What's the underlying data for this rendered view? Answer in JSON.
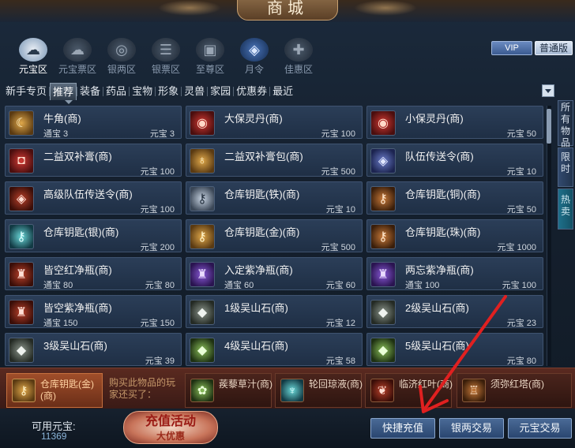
{
  "window": {
    "title": "商城"
  },
  "categories": [
    {
      "label": "元宝区",
      "icon": "ingot-icon",
      "active": true
    },
    {
      "label": "元宝票区",
      "icon": "cloud-ticket-icon",
      "active": false
    },
    {
      "label": "银两区",
      "icon": "silver-coins-icon",
      "active": false
    },
    {
      "label": "银票区",
      "icon": "silver-ticket-icon",
      "active": false
    },
    {
      "label": "至尊区",
      "icon": "treasure-chest-icon",
      "active": false
    },
    {
      "label": "月令",
      "icon": "moon-badge-icon",
      "active": false
    },
    {
      "label": "佳惠区",
      "icon": "gift-icon",
      "active": false
    }
  ],
  "header_buttons": {
    "vip": "VIP",
    "normal": "普通版"
  },
  "tabs": [
    "新手专页",
    "推荐",
    "装备",
    "药品",
    "宝物",
    "形象",
    "灵兽",
    "家园",
    "优惠券",
    "最近"
  ],
  "active_tab": "推荐",
  "side_tabs": {
    "all": "所有物品",
    "limited": "限时",
    "hot": "热卖"
  },
  "items": [
    {
      "name": "牛角(商)",
      "pl": "通宝 3",
      "pr": "元宝 3",
      "icon": "horn-icon",
      "tone": "t-gold"
    },
    {
      "name": "大保灵丹(商)",
      "pl": "",
      "pr": "元宝 100",
      "icon": "pill-bowl-icon",
      "tone": "t-red"
    },
    {
      "name": "小保灵丹(商)",
      "pl": "",
      "pr": "元宝 50",
      "icon": "pill-bowl-icon",
      "tone": "t-red"
    },
    {
      "name": "二益双补膏(商)",
      "pl": "",
      "pr": "元宝 100",
      "icon": "ointment-box-icon",
      "tone": "t-red"
    },
    {
      "name": "二益双补膏包(商)",
      "pl": "",
      "pr": "元宝 500",
      "icon": "gold-pouch-icon",
      "tone": "t-gold"
    },
    {
      "name": "队伍传送令(商)",
      "pl": "",
      "pr": "元宝 10",
      "icon": "teleport-token-icon",
      "tone": "t-blue"
    },
    {
      "name": "高级队伍传送令(商)",
      "pl": "",
      "pr": "元宝 100",
      "icon": "teleport-token-icon",
      "tone": "t-crimson"
    },
    {
      "name": "仓库钥匙(铁)(商)",
      "pl": "",
      "pr": "元宝 10",
      "icon": "key-icon",
      "tone": "t-silver"
    },
    {
      "name": "仓库钥匙(铜)(商)",
      "pl": "",
      "pr": "元宝 50",
      "icon": "key-icon",
      "tone": "t-bronze"
    },
    {
      "name": "仓库钥匙(银)(商)",
      "pl": "",
      "pr": "元宝 200",
      "icon": "key-icon",
      "tone": "t-cyan"
    },
    {
      "name": "仓库钥匙(金)(商)",
      "pl": "",
      "pr": "元宝 500",
      "icon": "key-icon",
      "tone": "t-gold"
    },
    {
      "name": "仓库钥匙(珠)(商)",
      "pl": "",
      "pr": "元宝 1000",
      "icon": "key-icon",
      "tone": "t-bronze"
    },
    {
      "name": "皆空红净瓶(商)",
      "pl": "通宝 80",
      "pr": "元宝 80",
      "icon": "vase-icon",
      "tone": "t-crimson"
    },
    {
      "name": "入定紫净瓶(商)",
      "pl": "通宝 60",
      "pr": "元宝 60",
      "icon": "vase-icon",
      "tone": "t-purple"
    },
    {
      "name": "两忘紫净瓶(商)",
      "pl": "通宝 100",
      "pr": "元宝 100",
      "icon": "vase-icon",
      "tone": "t-purple"
    },
    {
      "name": "皆空紫净瓶(商)",
      "pl": "通宝 150",
      "pr": "元宝 150",
      "icon": "vase-icon",
      "tone": "t-crimson"
    },
    {
      "name": "1级吴山石(商)",
      "pl": "",
      "pr": "元宝 12",
      "icon": "stone-icon",
      "tone": "t-stone"
    },
    {
      "name": "2级吴山石(商)",
      "pl": "",
      "pr": "元宝 23",
      "icon": "stone-icon",
      "tone": "t-stone"
    },
    {
      "name": "3级吴山石(商)",
      "pl": "",
      "pr": "元宝 39",
      "icon": "stone-icon",
      "tone": "t-stone"
    },
    {
      "name": "4级吴山石(商)",
      "pl": "",
      "pr": "元宝 58",
      "icon": "stone-icon",
      "tone": "t-green"
    },
    {
      "name": "5级吴山石(商)",
      "pl": "",
      "pr": "元宝 80",
      "icon": "stone-icon",
      "tone": "t-green"
    }
  ],
  "recommend": {
    "first": {
      "name": "仓库钥匙(金)(商)",
      "icon": "key-icon"
    },
    "hint": "购买此物品的玩家还买了：",
    "items": [
      {
        "name": "蒺藜草汁(商)",
        "icon": "herb-juice-icon",
        "tone": "t-green"
      },
      {
        "name": "轮回琼液(商)",
        "icon": "elixir-icon",
        "tone": "t-cyan"
      },
      {
        "name": "临济红叶(商)",
        "icon": "red-leaf-icon",
        "tone": "t-crimson"
      },
      {
        "name": "须弥红塔(商)",
        "icon": "pagoda-icon",
        "tone": "t-bronze"
      }
    ]
  },
  "footer": {
    "available_label": "可用元宝:",
    "available_value": "11369",
    "promo_title": "充值活动",
    "promo_sub": "大优惠",
    "quick_recharge": "快捷充值",
    "silver_trade": "银两交易",
    "ingot_trade": "元宝交易"
  },
  "colors": {
    "annotation_arrow": "#e02020",
    "panel": "#22334a",
    "accent": "#8aa6cc"
  }
}
